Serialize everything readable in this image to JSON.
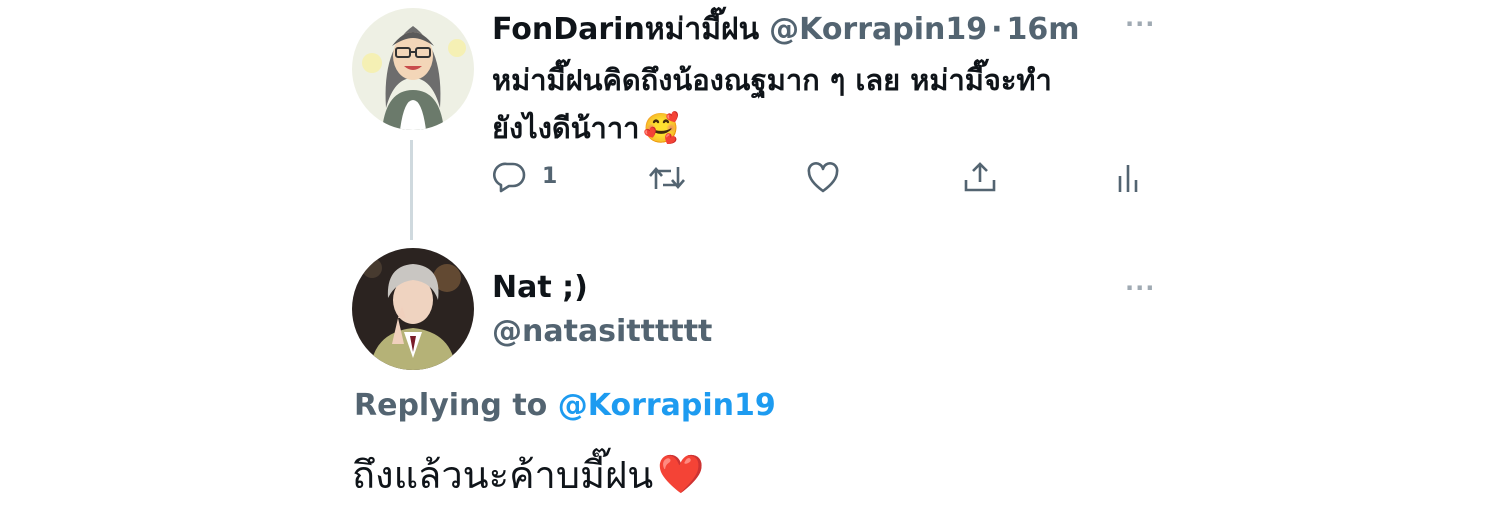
{
  "tweet": {
    "display_name": "FonDarinหม่ามี๊ฝน",
    "handle": "@Korrapin19",
    "separator": "·",
    "time": "16m",
    "more": "···",
    "text_line1": "หม่ามี๊ฝนคิดถึงน้องณฐมาก ๆ เลย หม่ามี๊จะทำ",
    "text_line2": "ยังไงดีน้าาา",
    "emoji": "🥰",
    "actions": {
      "reply_count": "1"
    },
    "icons": [
      "reply-icon",
      "retweet-icon",
      "like-icon",
      "share-icon",
      "analytics-icon"
    ]
  },
  "reply": {
    "display_name": "Nat ;)",
    "handle": "@natasitttttt",
    "more": "···",
    "replying_to_prefix": "Replying to",
    "replying_to_handle": "@Korrapin19",
    "text": "ถึงแล้วนะค้าบมี๊ฝน",
    "emoji": "❤️"
  },
  "colors": {
    "mention_blue": "#1d9bf0",
    "secondary_text": "#536471",
    "thread_line": "#cfd9de"
  }
}
